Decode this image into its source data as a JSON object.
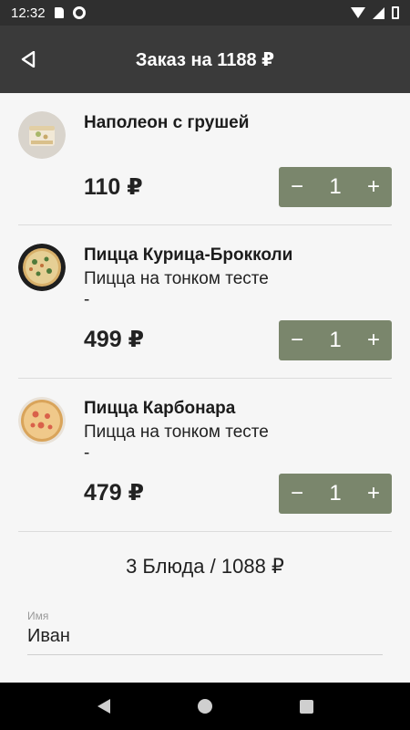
{
  "status_bar": {
    "time": "12:32",
    "icons": [
      "sd-card-icon",
      "gear-icon",
      "wifi-icon",
      "signal-icon",
      "battery-icon"
    ]
  },
  "app_bar": {
    "title": "Заказ на 1188 ₽",
    "back_icon": "back-arrow-icon"
  },
  "items": [
    {
      "name": "Наполеон с грушей",
      "description": "",
      "price": "110 ₽",
      "quantity": "1",
      "minus": "−",
      "plus": "+"
    },
    {
      "name": "Пицца Курица-Брокколи",
      "description": "Пицца на тонком тесте\n-",
      "price": "499 ₽",
      "quantity": "1",
      "minus": "−",
      "plus": "+"
    },
    {
      "name": "Пицца Карбонара",
      "description": "Пицца на тонком тесте\n-",
      "price": "479 ₽",
      "quantity": "1",
      "minus": "−",
      "plus": "+"
    }
  ],
  "summary": "3 Блюда / 1088 ₽",
  "form": {
    "name_label": "Имя",
    "name_value": "Иван"
  },
  "colors": {
    "app_bar": "#3a3a3a",
    "stepper": "#7a866c",
    "background": "#f6f6f6"
  }
}
